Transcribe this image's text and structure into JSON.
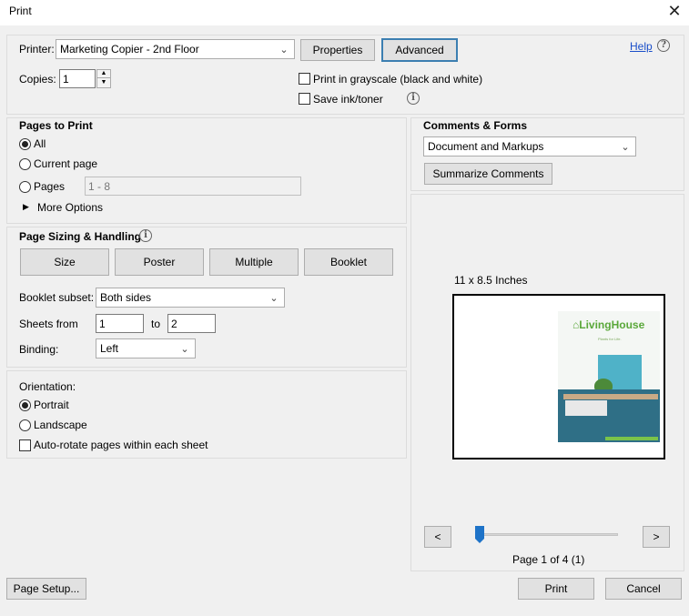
{
  "window": {
    "title": "Print",
    "close_icon": "close-icon"
  },
  "printer": {
    "label": "Printer:",
    "value": "Marketing Copier - 2nd Floor",
    "properties_label": "Properties",
    "advanced_label": "Advanced",
    "help_label": "Help",
    "copies_label": "Copies:",
    "copies_value": "1",
    "grayscale_label": "Print in grayscale (black and white)",
    "grayscale_checked": false,
    "save_ink_label": "Save ink/toner",
    "save_ink_checked": false
  },
  "pages_to_print": {
    "title": "Pages to Print",
    "options": [
      "All",
      "Current page",
      "Pages"
    ],
    "selected": "All",
    "pages_range_value": "1 - 8",
    "more_options_label": "More Options"
  },
  "page_sizing": {
    "title": "Page Sizing & Handling",
    "buttons": [
      "Size",
      "Poster",
      "Multiple",
      "Booklet"
    ],
    "booklet_subset_label": "Booklet subset:",
    "booklet_subset_value": "Both sides",
    "sheets_from_label": "Sheets from",
    "sheets_from_value": "1",
    "to_label": "to",
    "sheets_to_value": "2",
    "binding_label": "Binding:",
    "binding_value": "Left"
  },
  "orientation": {
    "title": "Orientation:",
    "options": [
      "Portrait",
      "Landscape"
    ],
    "selected": "Portrait",
    "auto_rotate_label": "Auto-rotate pages within each sheet",
    "auto_rotate_checked": false
  },
  "comments_forms": {
    "title": "Comments & Forms",
    "value": "Document and Markups",
    "summarize_label": "Summarize Comments"
  },
  "preview": {
    "size_label": "11 x 8.5 Inches",
    "thumb_logo_text": "LivingHouse",
    "thumb_tagline": "Plants for Life.",
    "prev_label": "<",
    "next_label": ">",
    "page_status": "Page 1 of 4 (1)",
    "slider_position_fraction": 0
  },
  "footer": {
    "page_setup_label": "Page Setup...",
    "print_label": "Print",
    "cancel_label": "Cancel"
  },
  "colors": {
    "accent": "#3c7fb1",
    "slider_thumb": "#1e73c8",
    "brand_green": "#5aa83a"
  }
}
